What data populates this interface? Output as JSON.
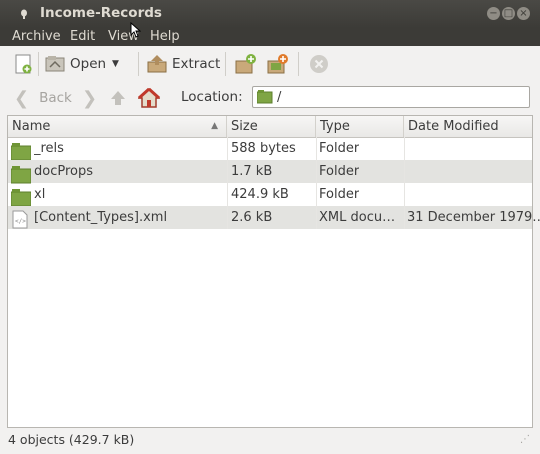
{
  "window": {
    "title": "Income-Records"
  },
  "menus": [
    "Archive",
    "Edit",
    "View",
    "Help"
  ],
  "toolbar": {
    "open": "Open",
    "extract": "Extract"
  },
  "nav": {
    "back": "Back",
    "location_label": "Location:",
    "location_value": "/"
  },
  "columns": {
    "name": "Name",
    "size": "Size",
    "type": "Type",
    "date": "Date Modified"
  },
  "files": [
    {
      "name": "_rels",
      "size": "588 bytes",
      "type": "Folder",
      "date": "",
      "kind": "folder"
    },
    {
      "name": "docProps",
      "size": "1.7 kB",
      "type": "Folder",
      "date": "",
      "kind": "folder"
    },
    {
      "name": "xl",
      "size": "424.9 kB",
      "type": "Folder",
      "date": "",
      "kind": "folder"
    },
    {
      "name": "[Content_Types].xml",
      "size": "2.6 kB",
      "type": "XML docu…",
      "date": "31 December 1979…",
      "kind": "xml"
    }
  ],
  "status": "4 objects (429.7 kB)",
  "colors": {
    "titlebar": "#3c3b37",
    "folder": "#7fa544",
    "selected_row": "#e3e3e0"
  }
}
